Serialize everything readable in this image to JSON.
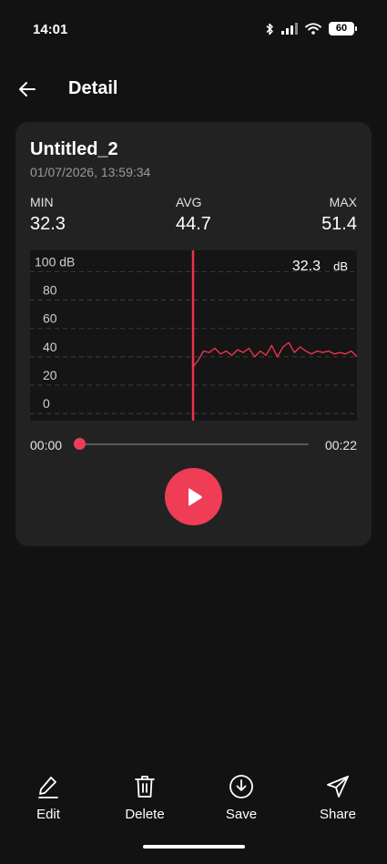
{
  "status_bar": {
    "time": "14:01",
    "battery": "60",
    "icons": [
      "bluetooth-icon",
      "signal-icon",
      "wifi-icon",
      "battery-icon"
    ]
  },
  "app_bar": {
    "title": "Detail",
    "back_icon": "arrow-left-icon"
  },
  "recording": {
    "title": "Untitled_2",
    "datetime": "01/07/2026, 13:59:34"
  },
  "stats": {
    "min_label": "MIN",
    "min_value": "32.3",
    "avg_label": "AVG",
    "avg_value": "44.7",
    "max_label": "MAX",
    "max_value": "51.4"
  },
  "chart": {
    "current_value": "32.3",
    "current_unit": "dB",
    "cursor_time_fraction": 0.5
  },
  "chart_data": {
    "type": "line",
    "y_tick_labels": [
      "100 dB",
      "80",
      "60",
      "40",
      "20",
      "0"
    ],
    "y_ticks": [
      100,
      80,
      60,
      40,
      20,
      0
    ],
    "ylim": [
      -5,
      115
    ],
    "grid": true,
    "series": [
      {
        "color": "#e8344c",
        "x": [
          0,
          0.4,
          0.8,
          1.2,
          1.6,
          2.0,
          2.4,
          2.8,
          3.2,
          3.6,
          4.0,
          4.4,
          4.8,
          5.2,
          5.6,
          6.0,
          6.4,
          6.8,
          7.2,
          7.6,
          8.0,
          8.4,
          8.8,
          9.2,
          9.6,
          10.0,
          10.4,
          10.8,
          11.2,
          11.6
        ],
        "y": [
          32,
          37,
          44,
          43,
          46,
          42,
          44,
          41,
          45,
          43,
          46,
          40,
          44,
          41,
          48,
          40,
          47,
          50,
          43,
          47,
          44,
          42,
          44,
          43,
          44,
          42,
          43,
          42,
          44,
          40
        ]
      }
    ]
  },
  "playback": {
    "elapsed": "00:00",
    "total": "00:22",
    "progress": 0.0,
    "play_icon": "play-icon"
  },
  "actions": [
    {
      "label": "Edit",
      "icon": "pencil-icon"
    },
    {
      "label": "Delete",
      "icon": "trash-icon"
    },
    {
      "label": "Save",
      "icon": "download-icon"
    },
    {
      "label": "Share",
      "icon": "send-icon"
    }
  ],
  "colors": {
    "accent": "#ef3d55",
    "background": "#121212",
    "card": "#222222"
  }
}
